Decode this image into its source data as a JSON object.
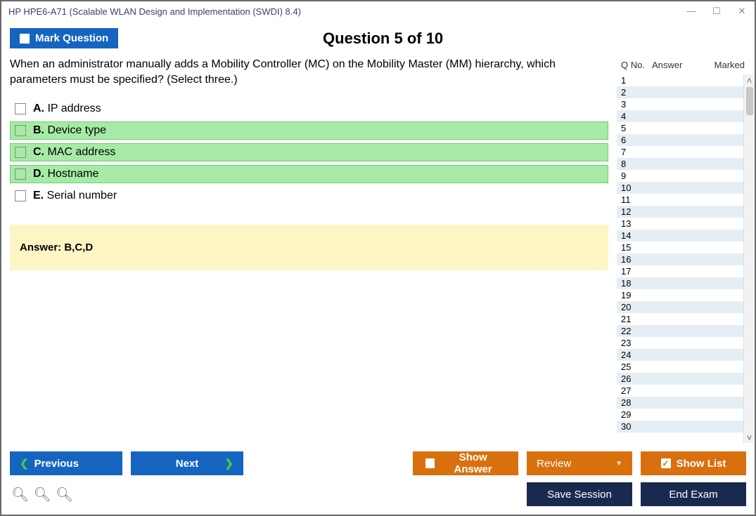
{
  "window": {
    "title": "HP HPE6-A71 (Scalable WLAN Design and Implementation (SWDI) 8.4)"
  },
  "header": {
    "mark_label": "Mark Question",
    "question_title": "Question 5 of 10"
  },
  "question": {
    "text": "When an administrator manually adds a Mobility Controller (MC) on the Mobility Master (MM) hierarchy, which parameters must be specified? (Select three.)",
    "options": [
      {
        "letter": "A.",
        "text": "IP address",
        "correct": false
      },
      {
        "letter": "B.",
        "text": "Device type",
        "correct": true
      },
      {
        "letter": "C.",
        "text": "MAC address",
        "correct": true
      },
      {
        "letter": "D.",
        "text": "Hostname",
        "correct": true
      },
      {
        "letter": "E.",
        "text": "Serial number",
        "correct": false
      }
    ],
    "answer_label": "Answer: B,C,D"
  },
  "sidebar": {
    "headers": {
      "qno": "Q No.",
      "answer": "Answer",
      "marked": "Marked"
    },
    "rows": [
      1,
      2,
      3,
      4,
      5,
      6,
      7,
      8,
      9,
      10,
      11,
      12,
      13,
      14,
      15,
      16,
      17,
      18,
      19,
      20,
      21,
      22,
      23,
      24,
      25,
      26,
      27,
      28,
      29,
      30
    ]
  },
  "footer": {
    "previous": "Previous",
    "next": "Next",
    "show_answer": "Show Answer",
    "review": "Review",
    "show_list": "Show List",
    "save_session": "Save Session",
    "end_exam": "End Exam"
  }
}
